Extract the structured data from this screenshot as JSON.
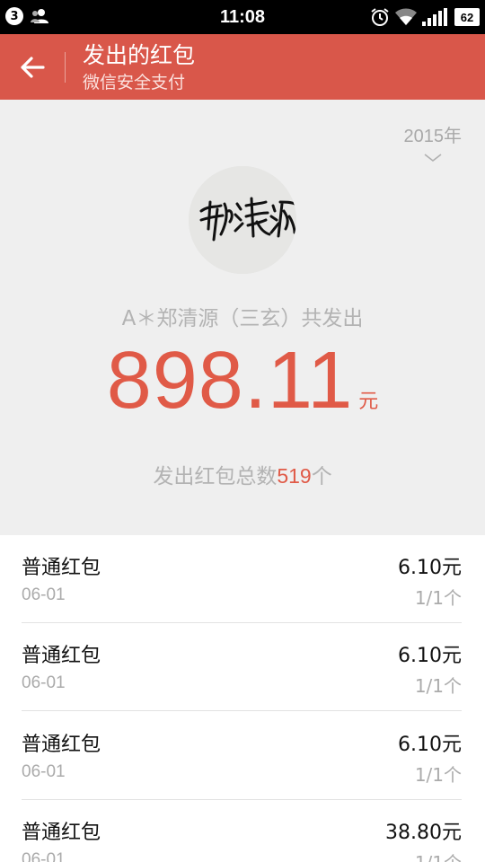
{
  "status_bar": {
    "notification_count": "3",
    "time": "11:08",
    "battery": "62"
  },
  "header": {
    "title": "发出的红包",
    "subtitle": "微信安全支付"
  },
  "summary": {
    "year": "2015年",
    "sender_text": "A＊郑清源（三玄）共发出",
    "total_amount": "898.11",
    "unit": "元",
    "count_prefix": "发出红包总数",
    "count_value": "519",
    "count_suffix": "个"
  },
  "packets": [
    {
      "type": "普通红包",
      "date": "06-01",
      "amount": "6.10元",
      "count": "1/1个"
    },
    {
      "type": "普通红包",
      "date": "06-01",
      "amount": "6.10元",
      "count": "1/1个"
    },
    {
      "type": "普通红包",
      "date": "06-01",
      "amount": "6.10元",
      "count": "1/1个"
    },
    {
      "type": "普通红包",
      "date": "06-01",
      "amount": "38.80元",
      "count": "1/1个"
    }
  ],
  "colors": {
    "accent_red": "#d9574a",
    "amount_red": "#e05a47"
  }
}
